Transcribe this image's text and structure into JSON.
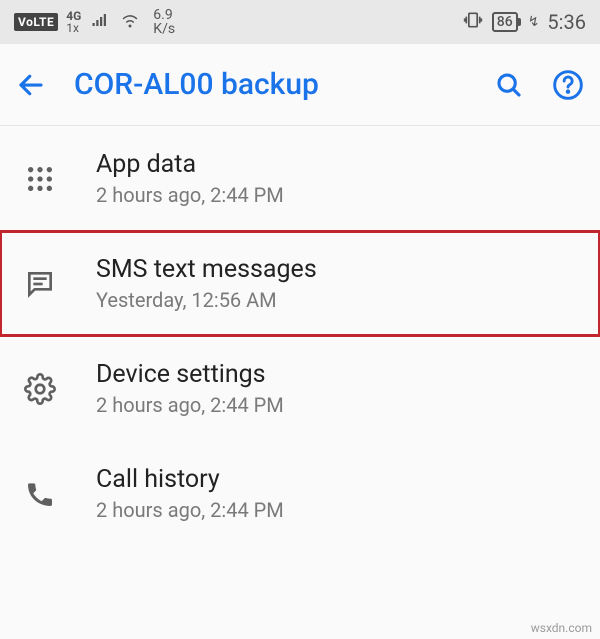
{
  "status": {
    "volte": "VoLTE",
    "net_top": "4G",
    "net_bottom": "1x",
    "speed_value": "6.9",
    "speed_unit": "K/s",
    "battery": "86",
    "clock": "5:36"
  },
  "appbar": {
    "title": "COR-AL00 backup"
  },
  "items": [
    {
      "title": "App data",
      "sub": "2 hours ago, 2:44 PM"
    },
    {
      "title": "SMS text messages",
      "sub": "Yesterday, 12:56 AM"
    },
    {
      "title": "Device settings",
      "sub": "2 hours ago, 2:44 PM"
    },
    {
      "title": "Call history",
      "sub": "2 hours ago, 2:44 PM"
    }
  ],
  "watermark": "wsxdn.com",
  "colors": {
    "accent": "#1a73e8",
    "highlight": "#c1262d"
  }
}
